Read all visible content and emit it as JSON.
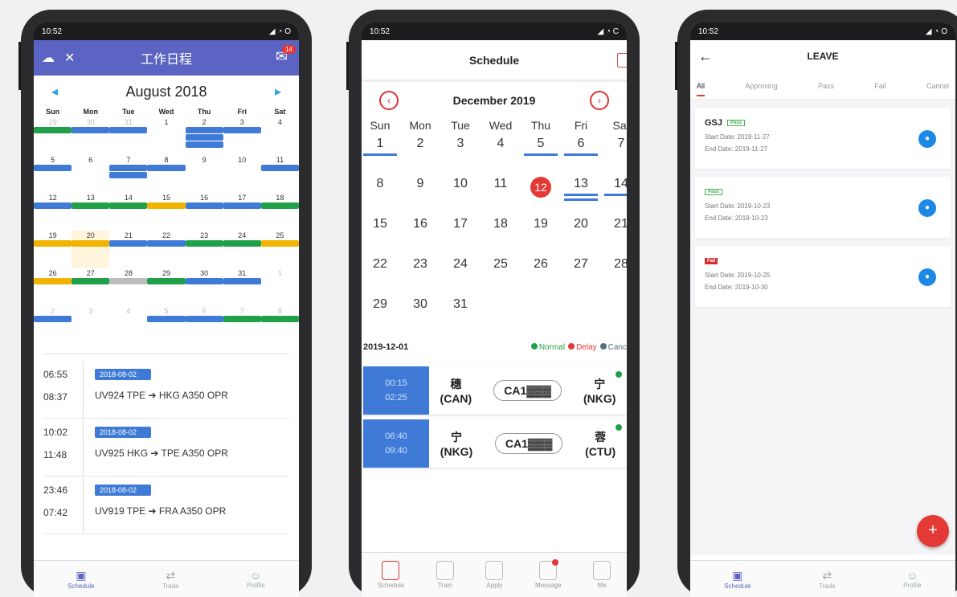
{
  "phone1": {
    "status": {
      "time": "10:52",
      "icons": "◢ ◔ O"
    },
    "appbar": {
      "title": "工作日程",
      "badge": "14"
    },
    "calendar": {
      "month": "August 2018",
      "weekdays": [
        "Sun",
        "Mon",
        "Tue",
        "Wed",
        "Thu",
        "Fri",
        "Sat"
      ],
      "days": [
        "29",
        "30",
        "31",
        "1",
        "2",
        "3",
        "4",
        "5",
        "6",
        "7",
        "8",
        "9",
        "10",
        "11",
        "12",
        "13",
        "14",
        "15",
        "16",
        "17",
        "18",
        "19",
        "20",
        "21",
        "22",
        "23",
        "24",
        "25",
        "26",
        "27",
        "28",
        "29",
        "30",
        "31",
        "1",
        "2",
        "3",
        "4",
        "5",
        "6",
        "7",
        "8"
      ]
    },
    "flights": [
      {
        "dep": "06:55",
        "arr": "08:37",
        "date": "2018-08-02",
        "route": "UV924 TPE ➔ HKG A350 OPR"
      },
      {
        "dep": "10:02",
        "arr": "11:48",
        "date": "2018-08-02",
        "route": "UV925 HKG ➔ TPE A350 OPR"
      },
      {
        "dep": "23:46",
        "arr": "07:42",
        "date": "2018-08-02",
        "route": "UV919 TPE ➔ FRA A350 OPR"
      }
    ],
    "nav": [
      {
        "label": "Schedule",
        "icon": "▣"
      },
      {
        "label": "Trade",
        "icon": "⇄"
      },
      {
        "label": "Profile",
        "icon": "☺"
      }
    ]
  },
  "phone2": {
    "status": {
      "time": "10:52",
      "icons": "◢ ◔ C"
    },
    "appbar": {
      "title": "Schedule"
    },
    "calendar": {
      "month": "December 2019",
      "weekdays": [
        "Sun",
        "Mon",
        "Tue",
        "Wed",
        "Thu",
        "Fri",
        "Sat"
      ],
      "days": [
        "1",
        "2",
        "3",
        "4",
        "5",
        "6",
        "7",
        "8",
        "9",
        "10",
        "11",
        "12",
        "13",
        "14",
        "15",
        "16",
        "17",
        "18",
        "19",
        "20",
        "21",
        "22",
        "23",
        "24",
        "25",
        "26",
        "27",
        "28",
        "29",
        "30",
        "31"
      ],
      "selected": "12"
    },
    "legend": {
      "date": "2019-12-01",
      "normal": "Normal",
      "delay": "Delay",
      "cancel": "Canc",
      "colors": {
        "normal": "#21a04a",
        "delay": "#e53935",
        "cancel": "#546e7a"
      }
    },
    "flights": [
      {
        "dep": "00:15",
        "arr": "02:25",
        "from_city": "穗",
        "from_code": "(CAN)",
        "flight": "CA1▓▓▓",
        "to_city": "宁",
        "to_code": "(NKG)"
      },
      {
        "dep": "06:40",
        "arr": "09:40",
        "from_city": "宁",
        "from_code": "(NKG)",
        "flight": "CA1▓▓▓",
        "to_city": "蓉",
        "to_code": "(CTU)"
      }
    ],
    "nav": [
      "Schedule",
      "Train",
      "Apply",
      "Message",
      "Me"
    ]
  },
  "phone3": {
    "status": {
      "time": "10:52",
      "icons": "◢ ◔ O"
    },
    "appbar": {
      "title": "LEAVE",
      "back": "←"
    },
    "tabs": [
      "All",
      "Approving",
      "Pass",
      "Fail",
      "Cancel"
    ],
    "cards": [
      {
        "name": "GSJ",
        "tag": "Pass",
        "start": "Start Date: 2019-11-27",
        "end": "End Date: 2019-11-27",
        "tagtype": "green"
      },
      {
        "name": "",
        "tag": "Pass",
        "start": "Start Date: 2019-10-23",
        "end": "End Date: 2019-10-23",
        "tagtype": "green"
      },
      {
        "name": "",
        "tag": "Fail",
        "start": "Start Date: 2019-10-25",
        "end": "End Date: 2019-10-30",
        "tagtype": "red"
      }
    ],
    "fab": "+",
    "nav": [
      {
        "label": "Schedule",
        "icon": "▣"
      },
      {
        "label": "Trade",
        "icon": "⇄"
      },
      {
        "label": "Profile",
        "icon": "☺"
      }
    ]
  }
}
